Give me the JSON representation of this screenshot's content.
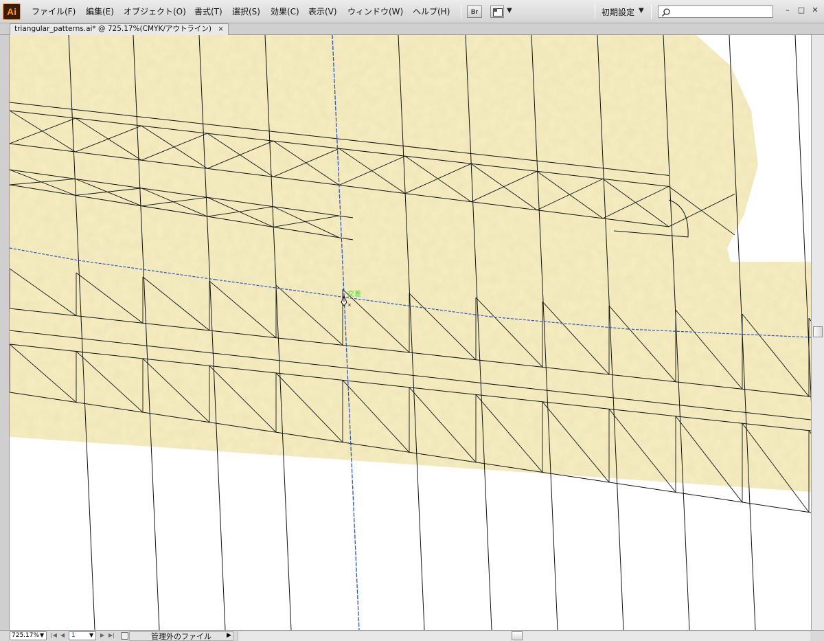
{
  "app": {
    "logo": "Ai"
  },
  "menu": {
    "items": [
      "ファイル(F)",
      "編集(E)",
      "オブジェクト(O)",
      "書式(T)",
      "選択(S)",
      "効果(C)",
      "表示(V)",
      "ウィンドウ(W)",
      "ヘルプ(H)"
    ],
    "bridge_label": "Br",
    "workspace": "初期設定",
    "search_placeholder": "",
    "window_controls": [
      "–",
      "□",
      "✕"
    ]
  },
  "document": {
    "tab_title": "triangular_patterns.ai* @ 725.17%(CMYK/アウトライン)",
    "tab_close": "×"
  },
  "canvas": {
    "snap_hint": "交差",
    "colors": {
      "paper": "#f7eec0",
      "paper_shadow": "#e9dc9a",
      "artboard": "#ffffff",
      "path": "#111111",
      "selected_path": "#2b54c8"
    }
  },
  "status": {
    "zoom": "725.17%",
    "page": "1",
    "info": "管理外のファイル"
  }
}
